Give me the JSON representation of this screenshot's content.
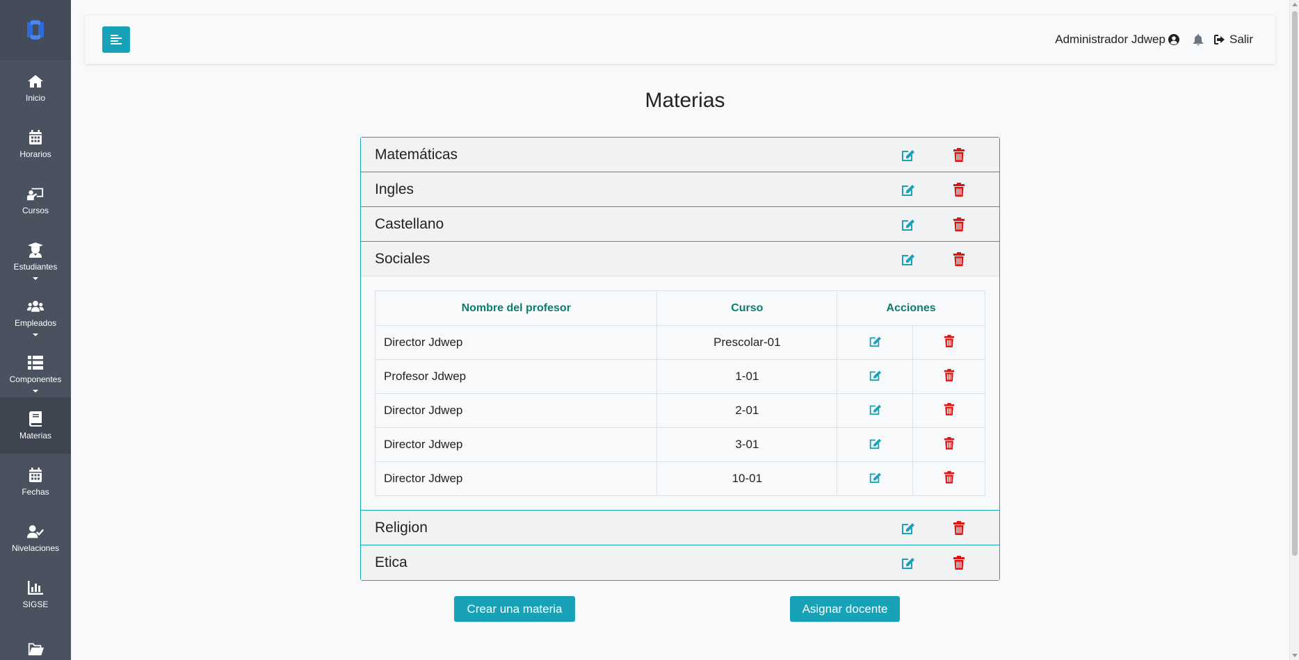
{
  "colors": {
    "accent": "#17a2b8",
    "danger": "#dc1414",
    "sidebar": "#4a5260",
    "header_text": "#0f7b6c"
  },
  "sidebar": {
    "items": [
      {
        "label": "Inicio",
        "icon": "home-icon"
      },
      {
        "label": "Horarios",
        "icon": "calendar-icon"
      },
      {
        "label": "Cursos",
        "icon": "chalkboard-teacher-icon"
      },
      {
        "label": "Estudiantes",
        "icon": "user-graduate-icon"
      },
      {
        "label": "Empleados",
        "icon": "users-icon"
      },
      {
        "label": "Componentes",
        "icon": "list-icon"
      },
      {
        "label": "Materias",
        "icon": "book-icon"
      },
      {
        "label": "Fechas",
        "icon": "calendar-icon"
      },
      {
        "label": "Nivelaciones",
        "icon": "user-check-icon"
      },
      {
        "label": "SIGSE",
        "icon": "chart-bar-icon"
      }
    ],
    "active": "Materias"
  },
  "topbar": {
    "user_name": "Administrador Jdwep",
    "logout_label": "Salir"
  },
  "page": {
    "title": "Materias"
  },
  "subjects": [
    {
      "name": "Matemáticas"
    },
    {
      "name": "Ingles"
    },
    {
      "name": "Castellano"
    },
    {
      "name": "Sociales",
      "expanded": true
    },
    {
      "name": "Religion"
    },
    {
      "name": "Etica"
    }
  ],
  "teachers_table": {
    "headers": {
      "name": "Nombre del profesor",
      "course": "Curso",
      "actions": "Acciones"
    },
    "rows": [
      {
        "name": "Director Jdwep",
        "course": "Prescolar-01"
      },
      {
        "name": "Profesor Jdwep",
        "course": "1-01"
      },
      {
        "name": "Director Jdwep",
        "course": "2-01"
      },
      {
        "name": "Director Jdwep",
        "course": "3-01"
      },
      {
        "name": "Director Jdwep",
        "course": "10-01"
      }
    ]
  },
  "buttons": {
    "create": "Crear una materia",
    "assign": "Asignar docente"
  }
}
